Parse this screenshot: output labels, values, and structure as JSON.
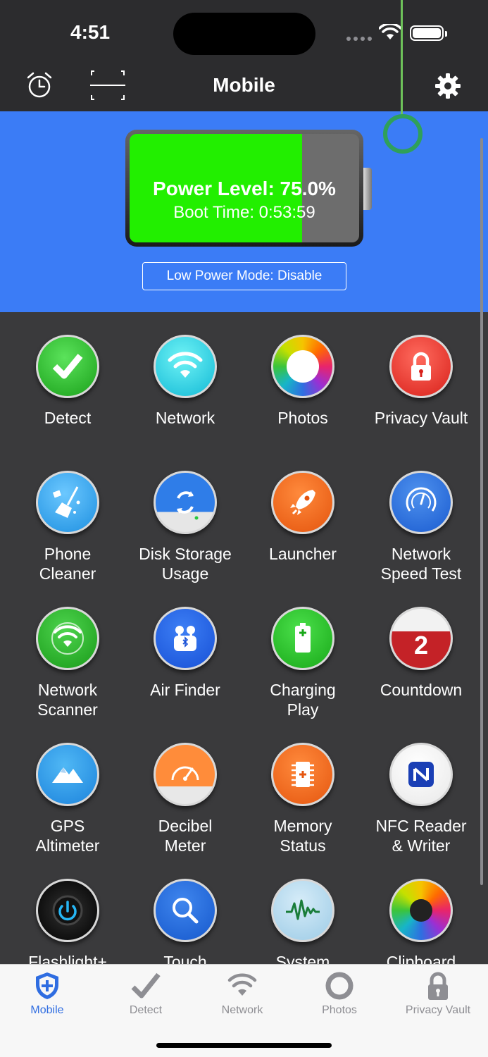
{
  "status_bar": {
    "time": "4:51"
  },
  "nav": {
    "title": "Mobile",
    "alarm_icon": "alarm-icon",
    "scan_icon": "scan-icon",
    "settings_icon": "gear-icon"
  },
  "battery": {
    "power_level_text": "Power Level: 75.0%",
    "power_level": 0.75,
    "boot_time_text": "Boot Time: 0:53:59",
    "low_power_button": "Low Power Mode: Disable",
    "colors": {
      "panel": "#3b7cf6",
      "level": "#22ef00"
    }
  },
  "tiles": [
    {
      "id": "detect",
      "label": "Detect",
      "icon": "checkmark-icon"
    },
    {
      "id": "network",
      "label": "Network",
      "icon": "wifi-icon"
    },
    {
      "id": "photos",
      "label": "Photos",
      "icon": "photos-icon"
    },
    {
      "id": "privacy-vault",
      "label": "Privacy Vault",
      "icon": "lock-icon"
    },
    {
      "id": "phone-cleaner",
      "label": "Phone\nCleaner",
      "icon": "broom-icon"
    },
    {
      "id": "disk-storage",
      "label": "Disk Storage\nUsage",
      "icon": "disk-icon"
    },
    {
      "id": "launcher",
      "label": "Launcher",
      "icon": "rocket-icon"
    },
    {
      "id": "network-speed-test",
      "label": "Network\nSpeed Test",
      "icon": "speedometer-icon"
    },
    {
      "id": "network-scanner",
      "label": "Network\nScanner",
      "icon": "wifi-scan-icon"
    },
    {
      "id": "air-finder",
      "label": "Air Finder",
      "icon": "earbuds-icon"
    },
    {
      "id": "charging-play",
      "label": "Charging\nPlay",
      "icon": "battery-icon"
    },
    {
      "id": "countdown",
      "label": "Countdown",
      "icon": "calendar-icon",
      "badge": "2"
    },
    {
      "id": "gps-altimeter",
      "label": "GPS\nAltimeter",
      "icon": "mountain-icon"
    },
    {
      "id": "decibel-meter",
      "label": "Decibel\nMeter",
      "icon": "gauge-icon"
    },
    {
      "id": "memory-status",
      "label": "Memory\nStatus",
      "icon": "chip-icon"
    },
    {
      "id": "nfc",
      "label": "NFC Reader\n& Writer",
      "icon": "nfc-icon"
    },
    {
      "id": "flashlight",
      "label": "Flashlight+",
      "icon": "power-icon"
    },
    {
      "id": "touch",
      "label": "Touch",
      "icon": "magnifier-icon"
    },
    {
      "id": "system",
      "label": "System",
      "icon": "waveform-icon"
    },
    {
      "id": "clipboard",
      "label": "Clipboard",
      "icon": "aperture-icon"
    }
  ],
  "tab_bar": [
    {
      "label": "Mobile",
      "icon": "shield-plus-icon",
      "active": true
    },
    {
      "label": "Detect",
      "icon": "checkmark-icon",
      "active": false
    },
    {
      "label": "Network",
      "icon": "wifi-icon",
      "active": false
    },
    {
      "label": "Photos",
      "icon": "ring-icon",
      "active": false
    },
    {
      "label": "Privacy Vault",
      "icon": "lock-icon",
      "active": false
    }
  ]
}
